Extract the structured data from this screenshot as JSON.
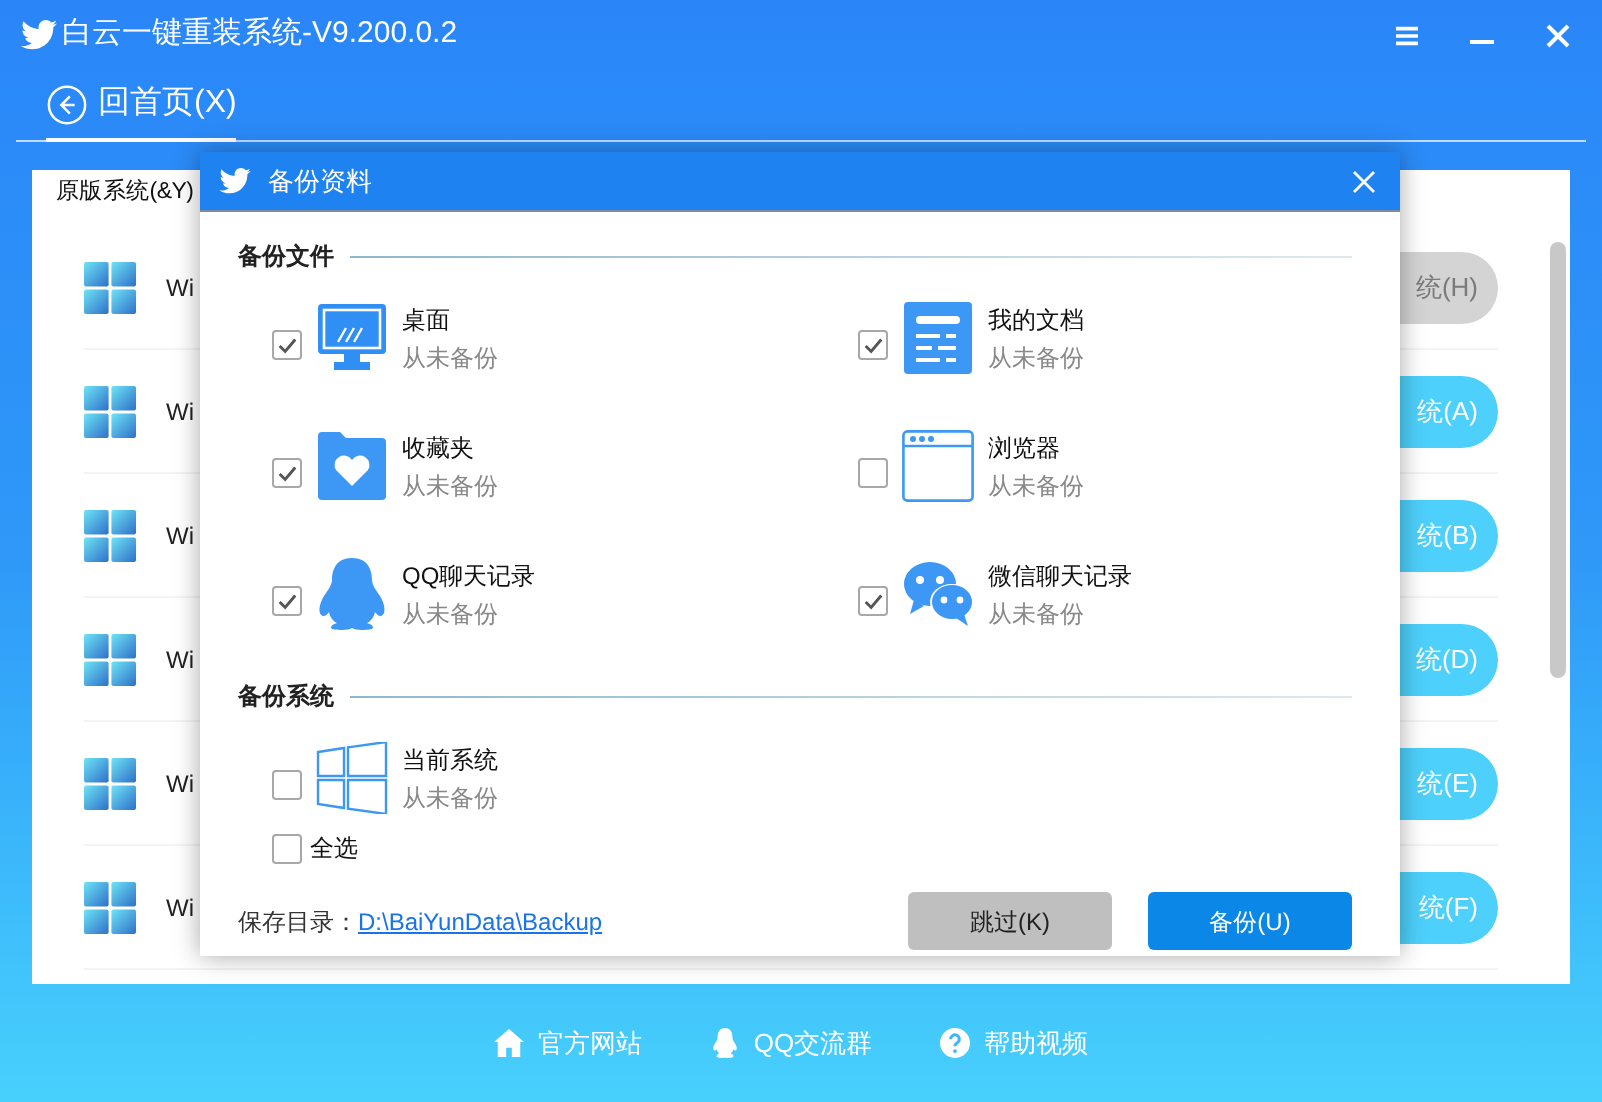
{
  "window": {
    "title": "白云一键重装系统-V9.200.0.2"
  },
  "nav": {
    "back_label": "回首页(X)"
  },
  "tabs": [
    {
      "label": "原版系统(&Y)",
      "selected": true
    }
  ],
  "system_list": [
    {
      "name": "Wi",
      "button": "统(H)",
      "disabled": true
    },
    {
      "name": "Wi",
      "button": "统(A)",
      "disabled": false
    },
    {
      "name": "Wi",
      "button": "统(B)",
      "disabled": false
    },
    {
      "name": "Wi",
      "button": "统(D)",
      "disabled": false
    },
    {
      "name": "Wi",
      "button": "统(E)",
      "disabled": false
    },
    {
      "name": "Wi",
      "button": "统(F)",
      "disabled": false
    }
  ],
  "dialog": {
    "title": "备份资料",
    "sections": [
      {
        "title": "备份文件",
        "items": [
          {
            "kind": "desktop",
            "label": "桌面",
            "status": "从未备份",
            "checked": true
          },
          {
            "kind": "documents",
            "label": "我的文档",
            "status": "从未备份",
            "checked": true
          },
          {
            "kind": "favorites",
            "label": "收藏夹",
            "status": "从未备份",
            "checked": true
          },
          {
            "kind": "browser",
            "label": "浏览器",
            "status": "从未备份",
            "checked": false
          },
          {
            "kind": "qq",
            "label": "QQ聊天记录",
            "status": "从未备份",
            "checked": true
          },
          {
            "kind": "wechat",
            "label": "微信聊天记录",
            "status": "从未备份",
            "checked": true
          }
        ]
      },
      {
        "title": "备份系统",
        "items": [
          {
            "kind": "system",
            "label": "当前系统",
            "status": "从未备份",
            "checked": false
          }
        ]
      }
    ],
    "select_all": {
      "label": "全选",
      "checked": false
    },
    "save_dir_label": "保存目录：",
    "save_dir": "D:\\BaiYunData\\Backup",
    "buttons": [
      {
        "kind": "secondary",
        "label": "跳过(K)"
      },
      {
        "kind": "primary",
        "label": "备份(U)"
      }
    ]
  },
  "footer_links": [
    {
      "kind": "home",
      "label": "官方网站"
    },
    {
      "kind": "qq",
      "label": "QQ交流群"
    },
    {
      "kind": "help",
      "label": "帮助视频"
    }
  ]
}
